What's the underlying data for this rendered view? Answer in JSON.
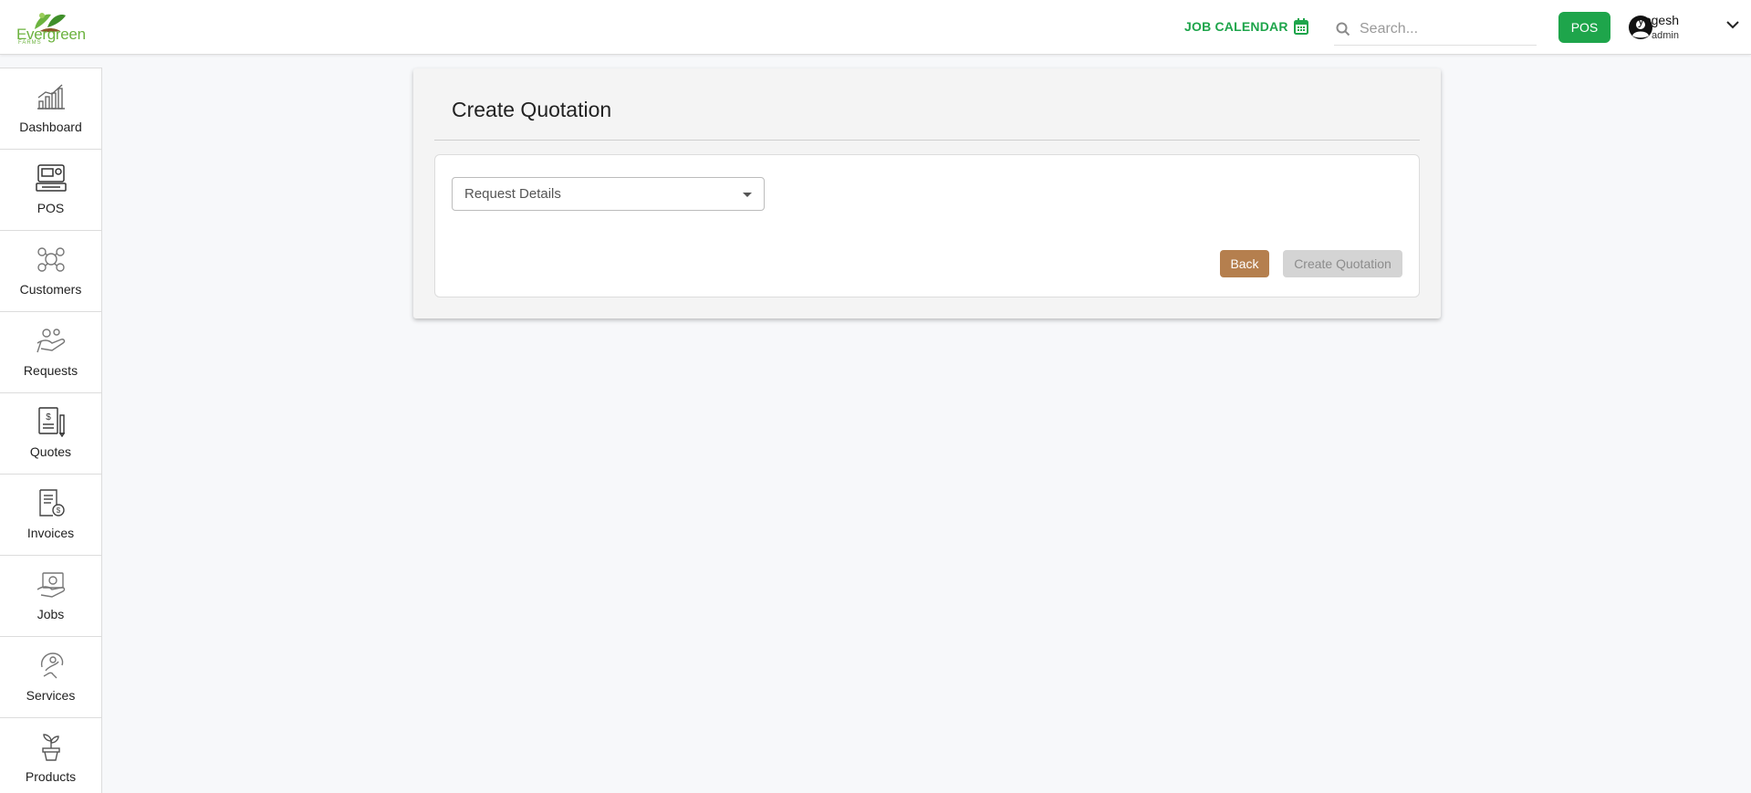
{
  "brand": {
    "name": "Evergreen",
    "sub": "FARMS",
    "color": "#6cb33f"
  },
  "header": {
    "job_calendar_label": "JOB CALENDAR",
    "search_placeholder": "Search...",
    "pos_label": "POS",
    "user": {
      "name": "yogesh",
      "role": "admin"
    },
    "accent": "#1ea54b"
  },
  "sidebar": {
    "items": [
      {
        "label": "Dashboard",
        "icon": "chart-icon"
      },
      {
        "label": "POS",
        "icon": "pos-terminal-icon"
      },
      {
        "label": "Customers",
        "icon": "customers-icon"
      },
      {
        "label": "Requests",
        "icon": "requests-icon"
      },
      {
        "label": "Quotes",
        "icon": "quote-document-icon"
      },
      {
        "label": "Invoices",
        "icon": "invoice-icon"
      },
      {
        "label": "Jobs",
        "icon": "jobs-icon"
      },
      {
        "label": "Services",
        "icon": "services-icon"
      },
      {
        "label": "Products",
        "icon": "plant-pot-icon"
      }
    ]
  },
  "main": {
    "title": "Create Quotation",
    "request_select_label": "Request Details",
    "back_label": "Back",
    "create_label": "Create Quotation",
    "back_color": "#b57f4e"
  }
}
